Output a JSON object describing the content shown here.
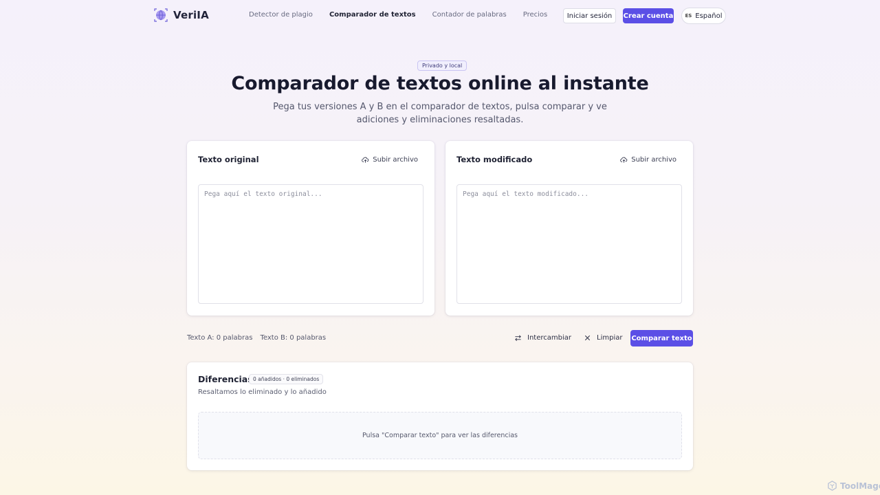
{
  "brand": {
    "name": "VeriIA",
    "logo_icon": "globe-logo-icon",
    "accent": "#5b4fe6"
  },
  "nav": {
    "links": [
      "Detector de plagio",
      "Comparador de textos",
      "Contador de palabras",
      "Precios"
    ],
    "active": "Comparador de textos",
    "login_label": "Iniciar sesión",
    "signup_label": "Crear cuenta",
    "lang_code": "ES",
    "lang_label": "Español"
  },
  "hero": {
    "badge": "Privado y local",
    "title": "Comparador de textos online al instante",
    "subtitle": "Pega tus versiones A y B en el comparador de textos, pulsa comparar y ve adiciones y eliminaciones resaltadas."
  },
  "editor_a": {
    "title": "Texto original",
    "upload_label": "Subir archivo",
    "placeholder": "Pega aquí el texto original...",
    "value": ""
  },
  "editor_b": {
    "title": "Texto modificado",
    "upload_label": "Subir archivo",
    "placeholder": "Pega aquí el texto modificado...",
    "value": ""
  },
  "counts": {
    "a": "Texto A: 0 palabras",
    "b": "Texto B: 0 palabras"
  },
  "actions": {
    "swap_label": "Intercambiar",
    "clear_label": "Limpiar",
    "compare_label": "Comparar texto"
  },
  "diff": {
    "title": "Diferencias",
    "badge": "0 añadidos · 0 eliminados",
    "subtitle": "Resaltamos lo eliminado y lo añadido",
    "empty_message": "Pulsa \"Comparar texto\" para ver las diferencias"
  },
  "watermark": {
    "text": "ToolMage"
  }
}
